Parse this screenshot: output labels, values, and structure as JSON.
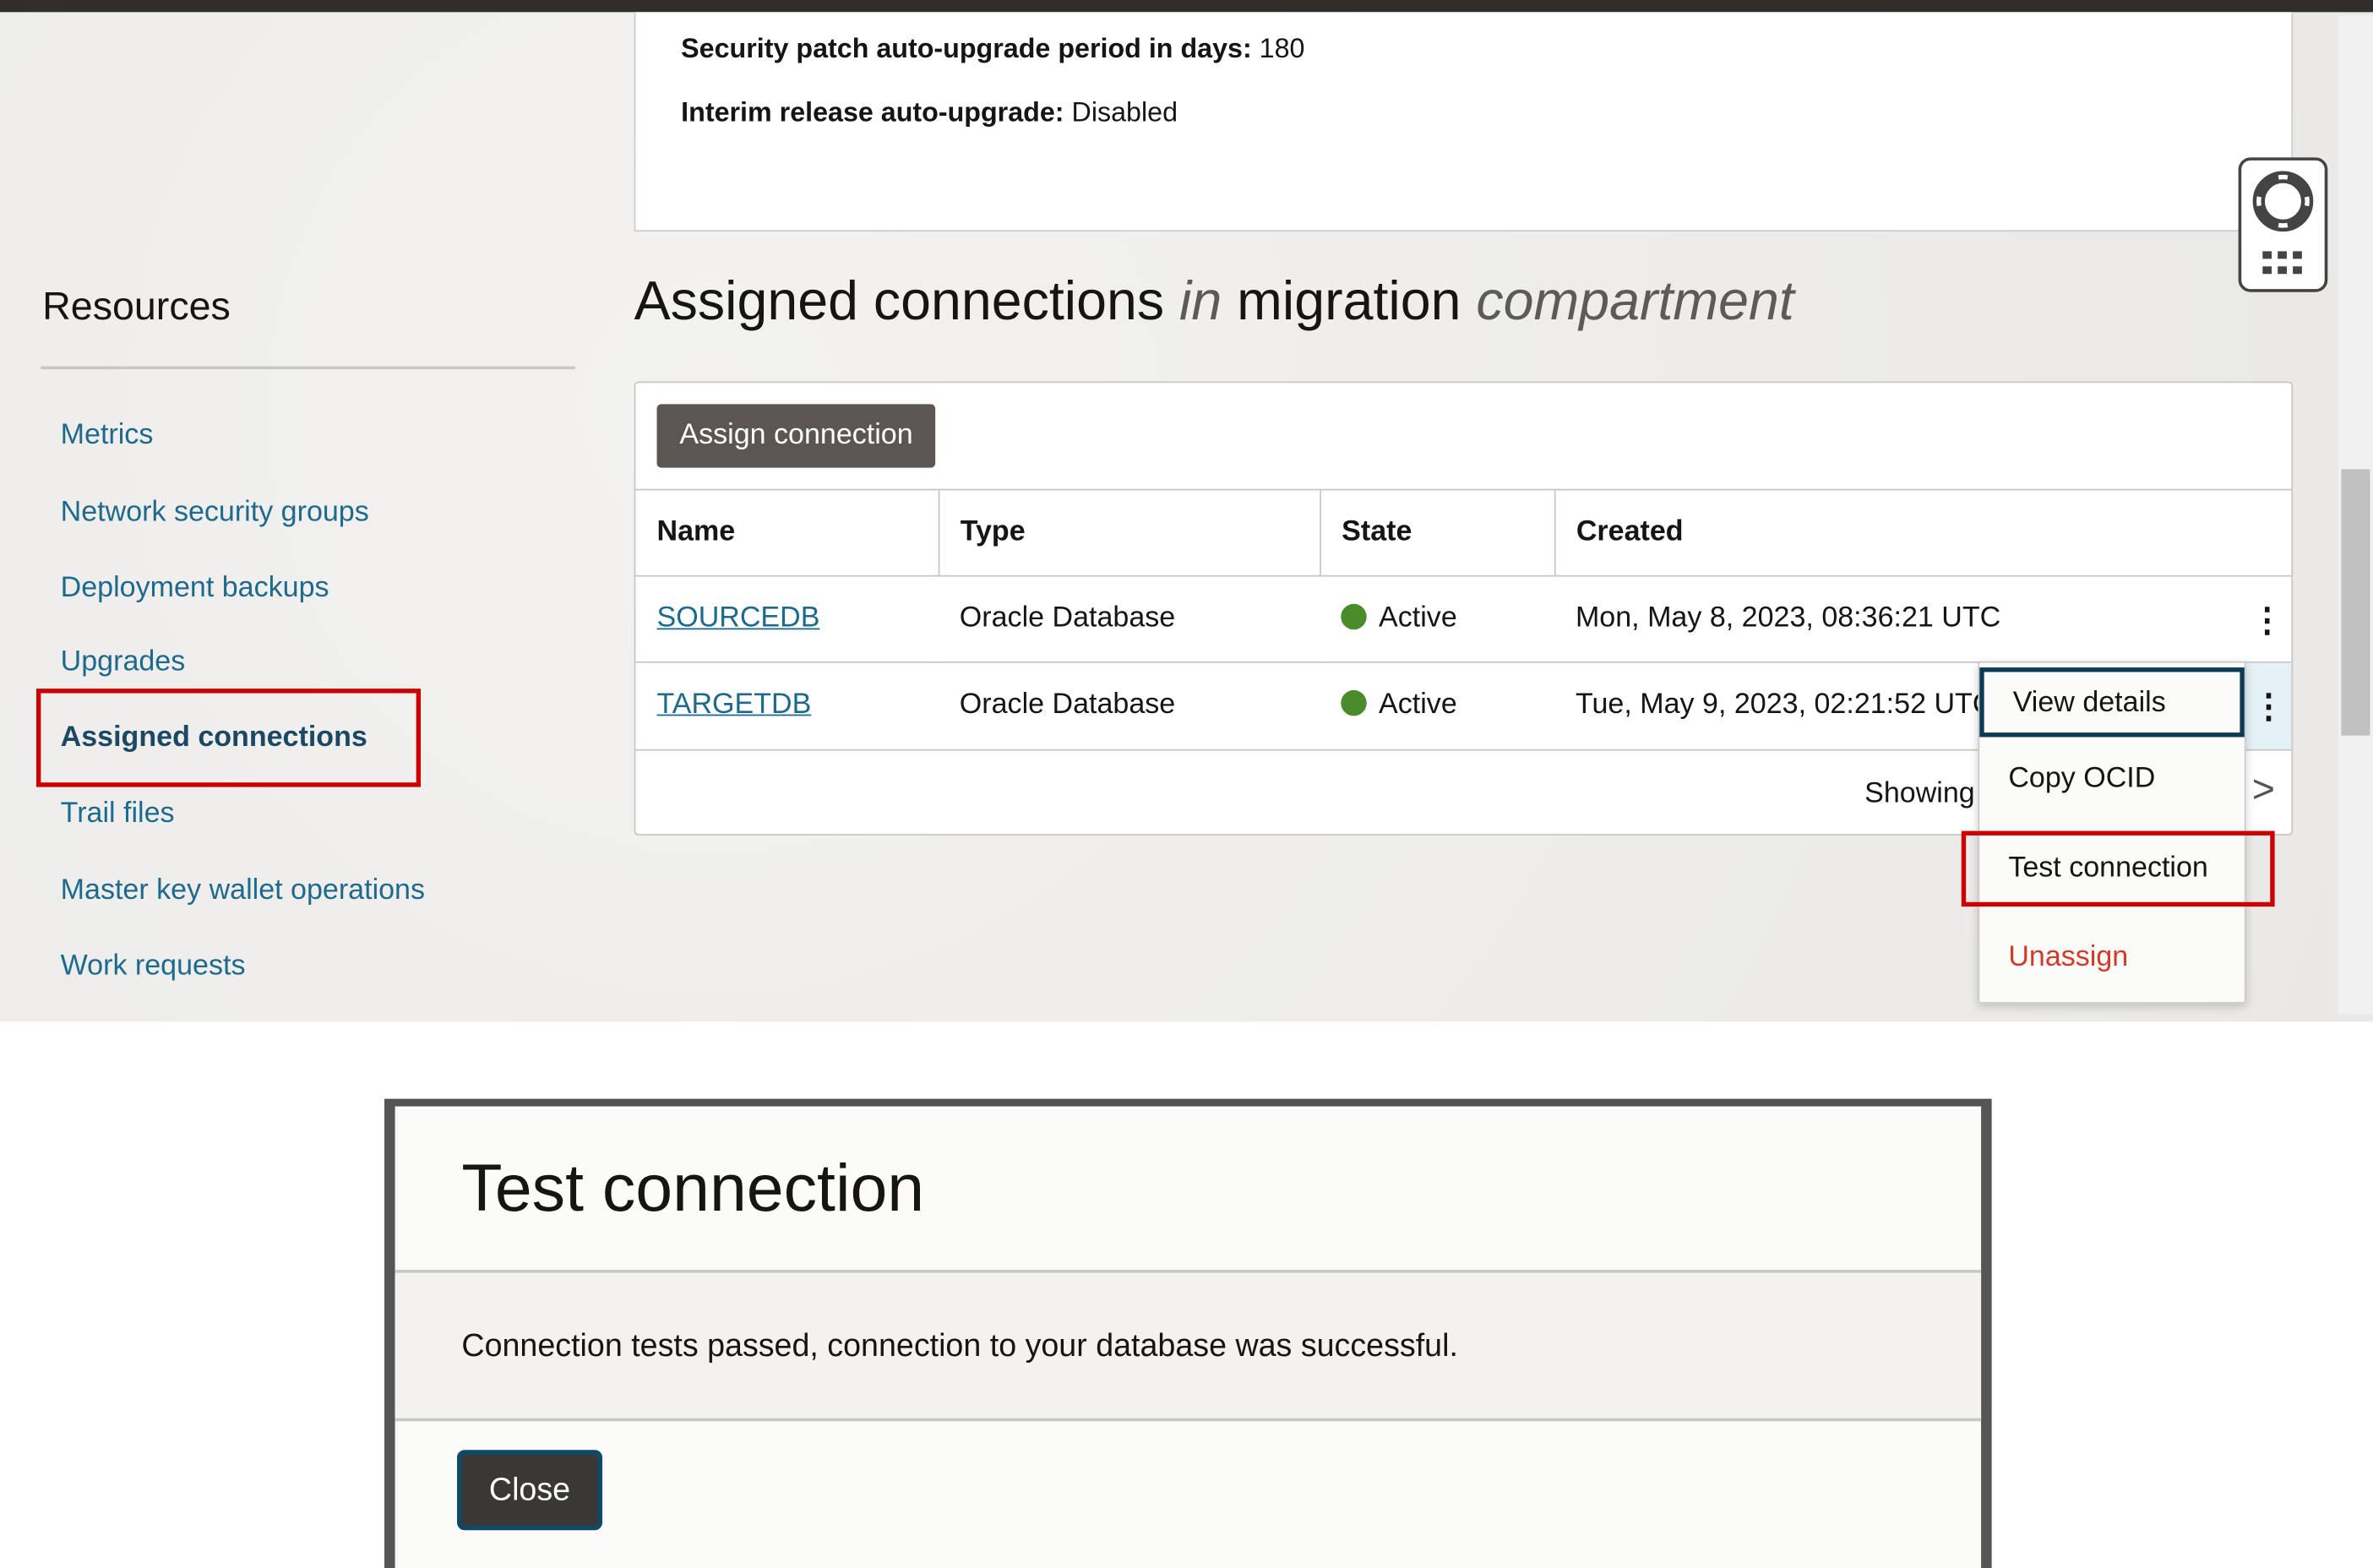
{
  "info": {
    "patch_label": "Security patch auto-upgrade period in days:",
    "patch_value": "180",
    "interim_label": "Interim release auto-upgrade:",
    "interim_value": "Disabled"
  },
  "resources": {
    "title": "Resources",
    "items": [
      "Metrics",
      "Network security groups",
      "Deployment backups",
      "Upgrades",
      "Assigned connections",
      "Trail files",
      "Master key wallet operations",
      "Work requests"
    ],
    "active": "Assigned connections"
  },
  "heading": {
    "part1": "Assigned connections",
    "in": "in",
    "part2": "migration",
    "compartment": "compartment"
  },
  "table": {
    "assign_label": "Assign connection",
    "columns": [
      "Name",
      "Type",
      "State",
      "Created"
    ],
    "rows": [
      {
        "name": "SOURCEDB",
        "type": "Oracle Database",
        "state": "Active",
        "created": "Mon, May 8, 2023, 08:36:21 UTC"
      },
      {
        "name": "TARGETDB",
        "type": "Oracle Database",
        "state": "Active",
        "created": "Tue, May 9, 2023, 02:21:52 UTC"
      }
    ],
    "showing": "Showing",
    "state_color": "#4a8c2a"
  },
  "menu": {
    "items": [
      "View details",
      "Copy OCID",
      "Test connection",
      "Unassign"
    ]
  },
  "dialog": {
    "title": "Test connection",
    "message": "Connection tests passed, connection to your database was successful.",
    "close_label": "Close"
  },
  "icons": {
    "help": "lifebuoy-icon",
    "apps": "grid-icon",
    "row_actions": "kebab-icon",
    "next": "chevron-right-icon"
  },
  "highlight_color": "#cc0000"
}
